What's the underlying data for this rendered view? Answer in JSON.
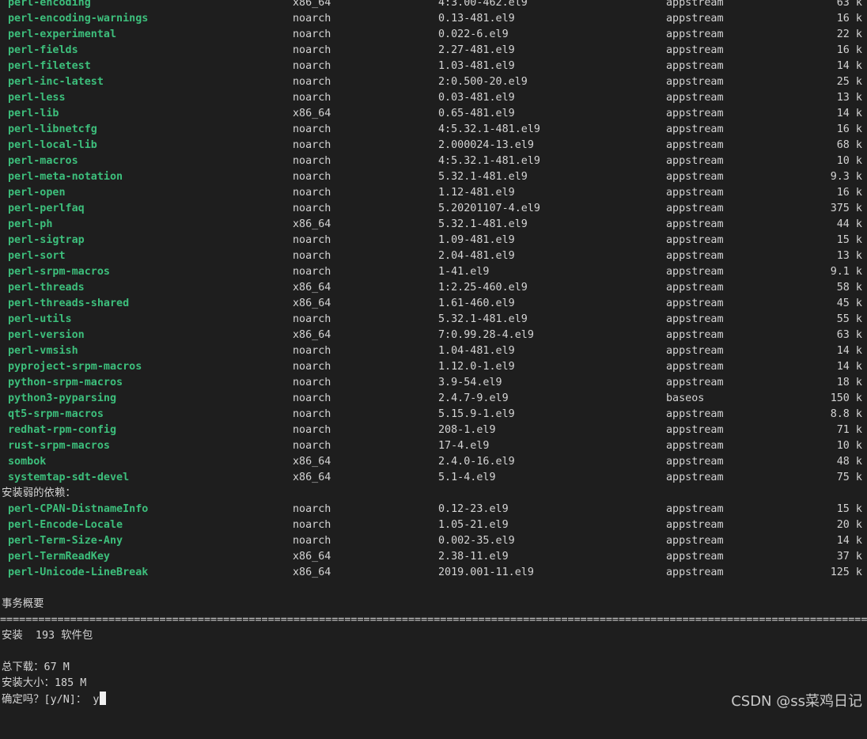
{
  "packages_main": [
    {
      "name": "perl-encoding",
      "arch": "x86_64",
      "version": "4:3.00-462.el9",
      "repo": "appstream",
      "size": "63 k"
    },
    {
      "name": "perl-encoding-warnings",
      "arch": "noarch",
      "version": "0.13-481.el9",
      "repo": "appstream",
      "size": "16 k"
    },
    {
      "name": "perl-experimental",
      "arch": "noarch",
      "version": "0.022-6.el9",
      "repo": "appstream",
      "size": "22 k"
    },
    {
      "name": "perl-fields",
      "arch": "noarch",
      "version": "2.27-481.el9",
      "repo": "appstream",
      "size": "16 k"
    },
    {
      "name": "perl-filetest",
      "arch": "noarch",
      "version": "1.03-481.el9",
      "repo": "appstream",
      "size": "14 k"
    },
    {
      "name": "perl-inc-latest",
      "arch": "noarch",
      "version": "2:0.500-20.el9",
      "repo": "appstream",
      "size": "25 k"
    },
    {
      "name": "perl-less",
      "arch": "noarch",
      "version": "0.03-481.el9",
      "repo": "appstream",
      "size": "13 k"
    },
    {
      "name": "perl-lib",
      "arch": "x86_64",
      "version": "0.65-481.el9",
      "repo": "appstream",
      "size": "14 k"
    },
    {
      "name": "perl-libnetcfg",
      "arch": "noarch",
      "version": "4:5.32.1-481.el9",
      "repo": "appstream",
      "size": "16 k"
    },
    {
      "name": "perl-local-lib",
      "arch": "noarch",
      "version": "2.000024-13.el9",
      "repo": "appstream",
      "size": "68 k"
    },
    {
      "name": "perl-macros",
      "arch": "noarch",
      "version": "4:5.32.1-481.el9",
      "repo": "appstream",
      "size": "10 k"
    },
    {
      "name": "perl-meta-notation",
      "arch": "noarch",
      "version": "5.32.1-481.el9",
      "repo": "appstream",
      "size": "9.3 k"
    },
    {
      "name": "perl-open",
      "arch": "noarch",
      "version": "1.12-481.el9",
      "repo": "appstream",
      "size": "16 k"
    },
    {
      "name": "perl-perlfaq",
      "arch": "noarch",
      "version": "5.20201107-4.el9",
      "repo": "appstream",
      "size": "375 k"
    },
    {
      "name": "perl-ph",
      "arch": "x86_64",
      "version": "5.32.1-481.el9",
      "repo": "appstream",
      "size": "44 k"
    },
    {
      "name": "perl-sigtrap",
      "arch": "noarch",
      "version": "1.09-481.el9",
      "repo": "appstream",
      "size": "15 k"
    },
    {
      "name": "perl-sort",
      "arch": "noarch",
      "version": "2.04-481.el9",
      "repo": "appstream",
      "size": "13 k"
    },
    {
      "name": "perl-srpm-macros",
      "arch": "noarch",
      "version": "1-41.el9",
      "repo": "appstream",
      "size": "9.1 k"
    },
    {
      "name": "perl-threads",
      "arch": "x86_64",
      "version": "1:2.25-460.el9",
      "repo": "appstream",
      "size": "58 k"
    },
    {
      "name": "perl-threads-shared",
      "arch": "x86_64",
      "version": "1.61-460.el9",
      "repo": "appstream",
      "size": "45 k"
    },
    {
      "name": "perl-utils",
      "arch": "noarch",
      "version": "5.32.1-481.el9",
      "repo": "appstream",
      "size": "55 k"
    },
    {
      "name": "perl-version",
      "arch": "x86_64",
      "version": "7:0.99.28-4.el9",
      "repo": "appstream",
      "size": "63 k"
    },
    {
      "name": "perl-vmsish",
      "arch": "noarch",
      "version": "1.04-481.el9",
      "repo": "appstream",
      "size": "14 k"
    },
    {
      "name": "pyproject-srpm-macros",
      "arch": "noarch",
      "version": "1.12.0-1.el9",
      "repo": "appstream",
      "size": "14 k"
    },
    {
      "name": "python-srpm-macros",
      "arch": "noarch",
      "version": "3.9-54.el9",
      "repo": "appstream",
      "size": "18 k"
    },
    {
      "name": "python3-pyparsing",
      "arch": "noarch",
      "version": "2.4.7-9.el9",
      "repo": "baseos",
      "size": "150 k"
    },
    {
      "name": "qt5-srpm-macros",
      "arch": "noarch",
      "version": "5.15.9-1.el9",
      "repo": "appstream",
      "size": "8.8 k"
    },
    {
      "name": "redhat-rpm-config",
      "arch": "noarch",
      "version": "208-1.el9",
      "repo": "appstream",
      "size": "71 k"
    },
    {
      "name": "rust-srpm-macros",
      "arch": "noarch",
      "version": "17-4.el9",
      "repo": "appstream",
      "size": "10 k"
    },
    {
      "name": "sombok",
      "arch": "x86_64",
      "version": "2.4.0-16.el9",
      "repo": "appstream",
      "size": "48 k"
    },
    {
      "name": "systemtap-sdt-devel",
      "arch": "x86_64",
      "version": "5.1-4.el9",
      "repo": "appstream",
      "size": "75 k"
    }
  ],
  "weak_deps_header": "安装弱的依赖：",
  "packages_weak": [
    {
      "name": "perl-CPAN-DistnameInfo",
      "arch": "noarch",
      "version": "0.12-23.el9",
      "repo": "appstream",
      "size": "15 k"
    },
    {
      "name": "perl-Encode-Locale",
      "arch": "noarch",
      "version": "1.05-21.el9",
      "repo": "appstream",
      "size": "20 k"
    },
    {
      "name": "perl-Term-Size-Any",
      "arch": "noarch",
      "version": "0.002-35.el9",
      "repo": "appstream",
      "size": "14 k"
    },
    {
      "name": "perl-TermReadKey",
      "arch": "x86_64",
      "version": "2.38-11.el9",
      "repo": "appstream",
      "size": "37 k"
    },
    {
      "name": "perl-Unicode-LineBreak",
      "arch": "x86_64",
      "version": "2019.001-11.el9",
      "repo": "appstream",
      "size": "125 k"
    }
  ],
  "summary": {
    "title": "事务概要",
    "separator": "==================================================================================================================================================================================",
    "install_line": "安装  193 软件包",
    "total_download": "总下载：67 M",
    "installed_size": "安装大小：185 M",
    "prompt": "确定吗？[y/N]：",
    "input_value": " y"
  },
  "watermark": "CSDN @ss菜鸡日记"
}
